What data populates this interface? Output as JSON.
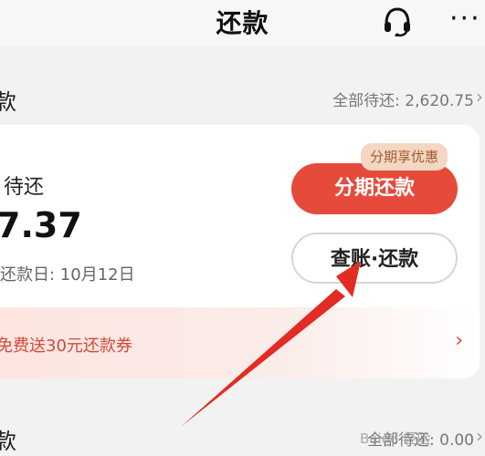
{
  "header": {
    "title": "还款",
    "support_icon": "headset-icon",
    "more_icon": "more-icon",
    "more_label": "···"
  },
  "section1": {
    "left_fragment": "款",
    "total_pending": "全部待还: 2,620.75",
    "chevron": "›"
  },
  "card": {
    "due_label": "待还",
    "amount": "7.37",
    "due_date": "还款日: 10月12日",
    "installment_button": "分期还款",
    "badge": "分期享优惠",
    "bill_button": "查账·还款",
    "promo_text": "免费送30元还款券",
    "promo_chevron": "›"
  },
  "section2": {
    "left_fragment": "款",
    "total_pending": "全部待还: 0.00",
    "chevron": "›"
  },
  "watermark": "Baidu 经验"
}
